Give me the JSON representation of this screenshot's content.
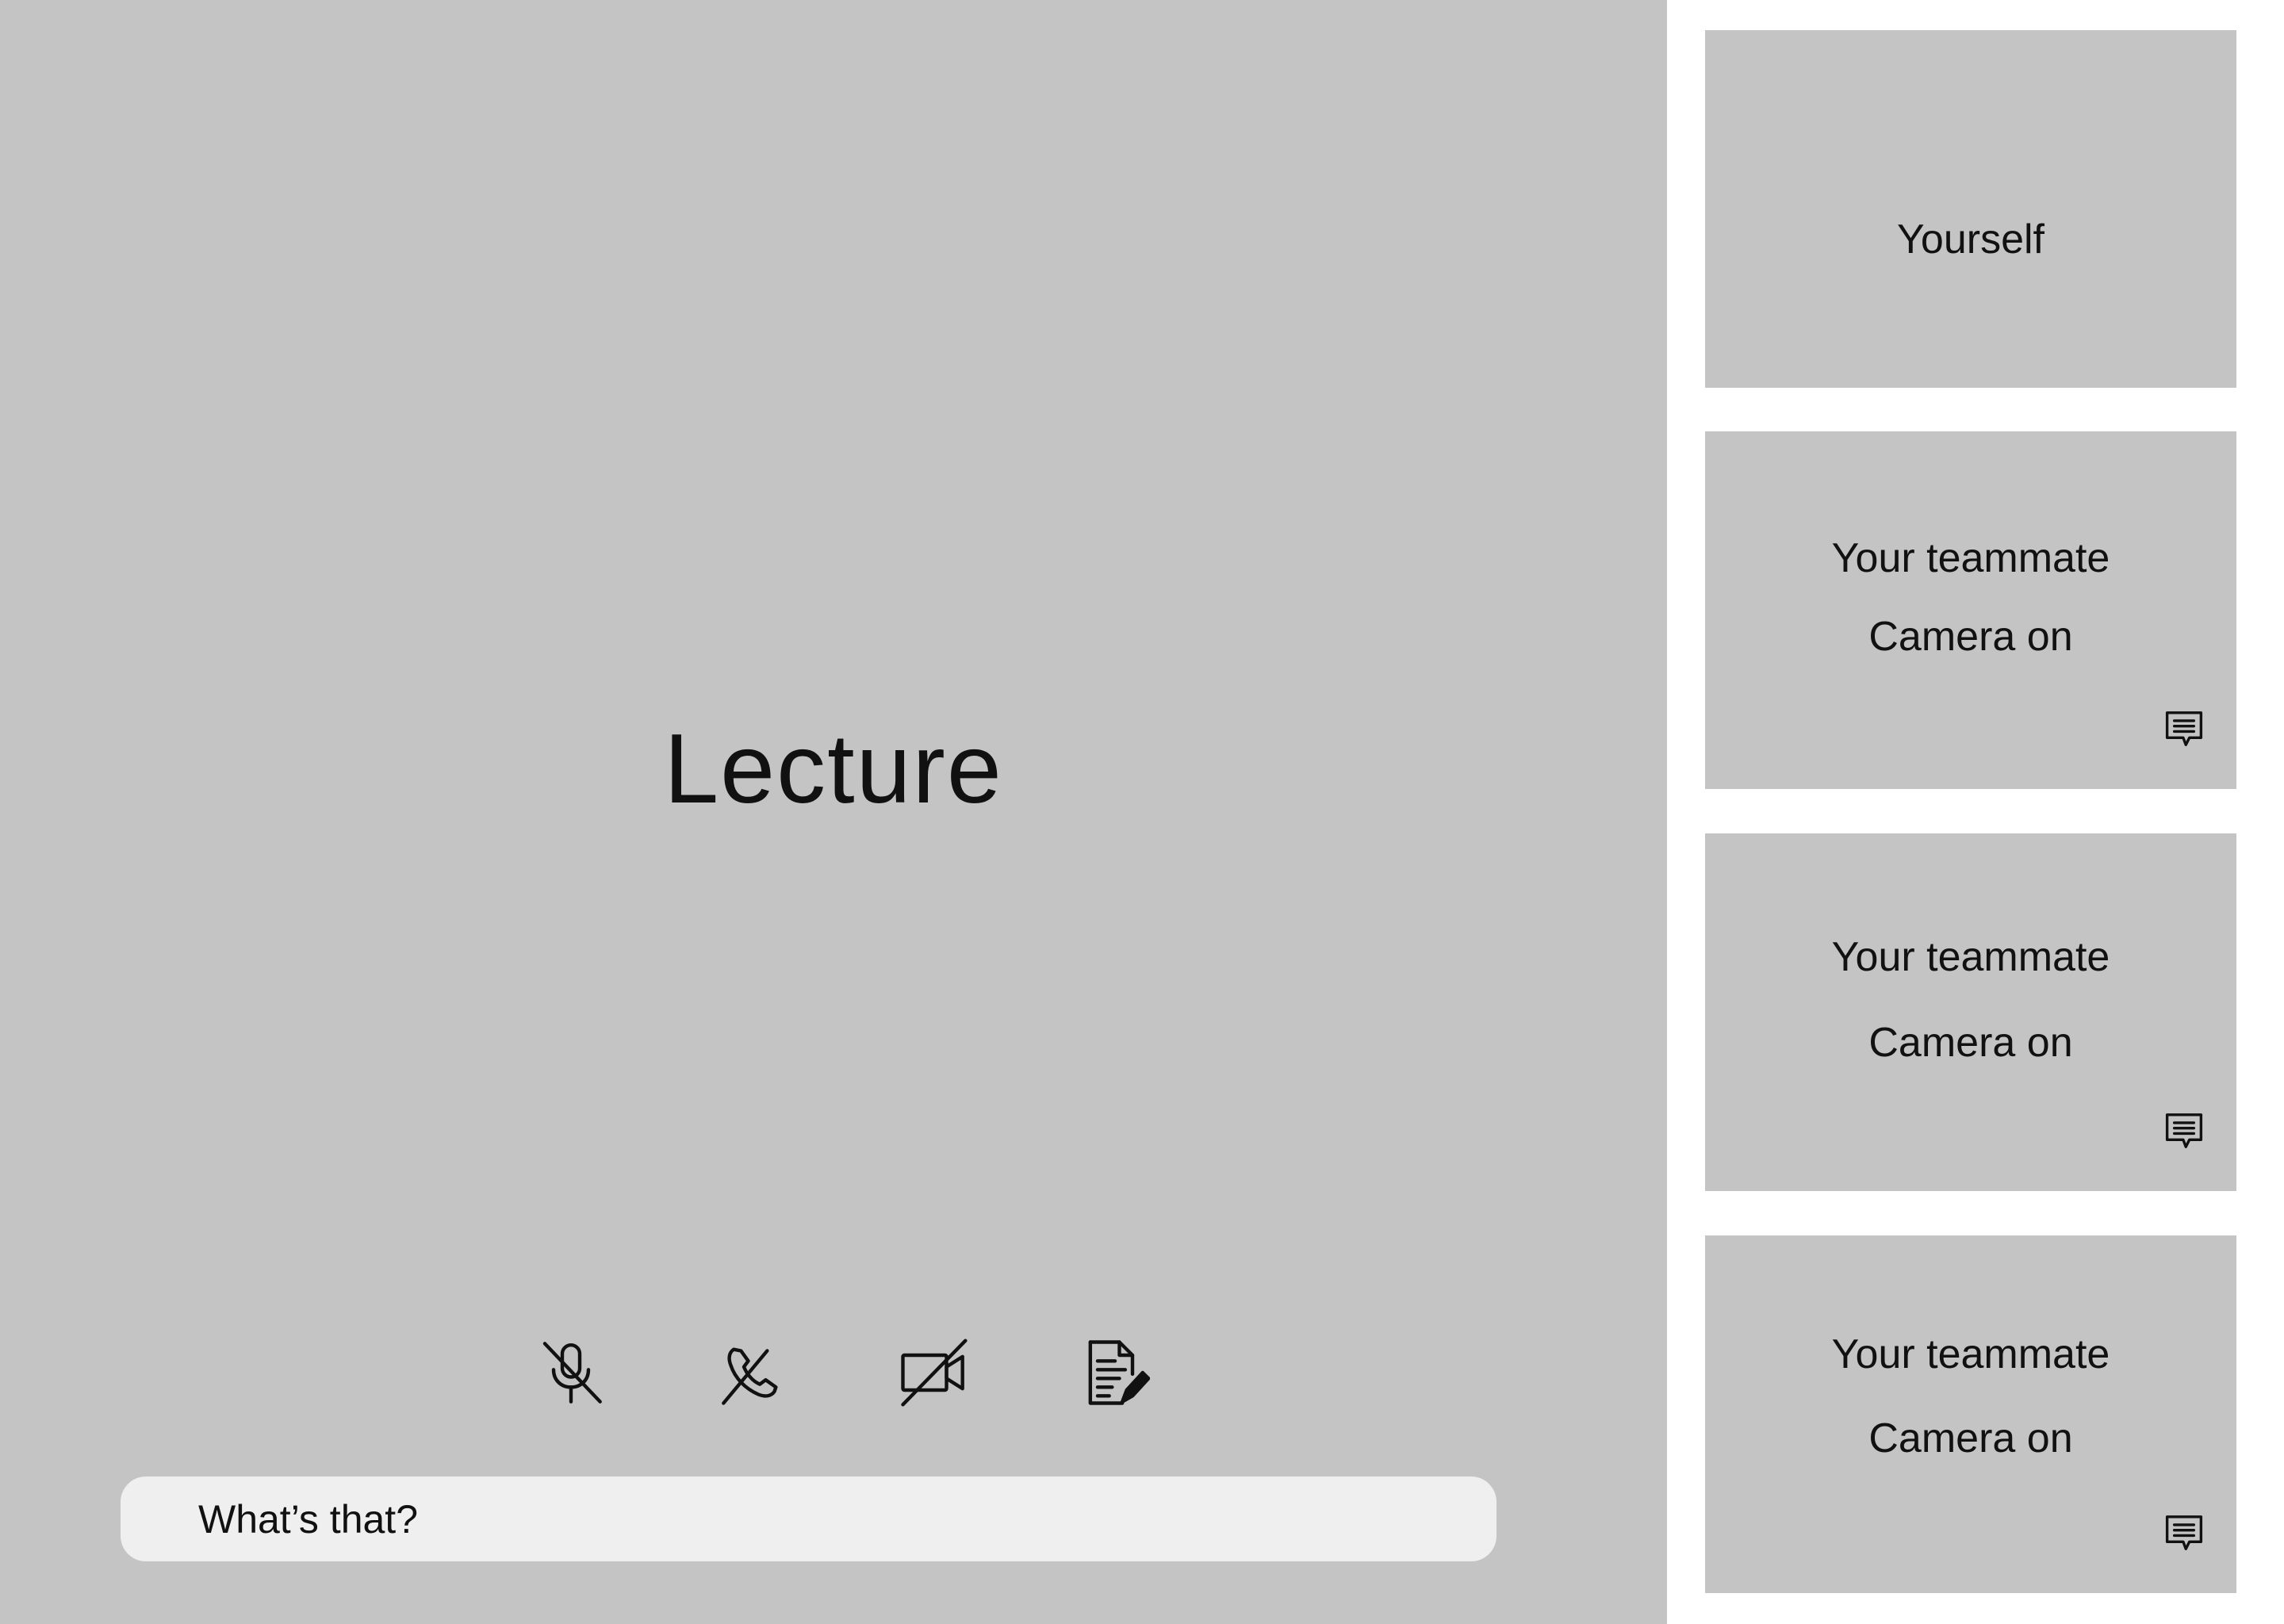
{
  "main": {
    "title": "Lecture",
    "chat_placeholder": "What’s that?",
    "controls": [
      {
        "icon": "microphone-off-icon"
      },
      {
        "icon": "phone-off-icon"
      },
      {
        "icon": "video-off-icon"
      },
      {
        "icon": "notes-edit-icon"
      }
    ]
  },
  "participants": [
    {
      "name": "Yourself"
    },
    {
      "name": "Your teammate",
      "status": "Camera on",
      "icon": "chat-icon"
    },
    {
      "name": "Your teammate",
      "status": "Camera on",
      "icon": "chat-icon"
    },
    {
      "name": "Your teammate",
      "status": "Camera on",
      "icon": "chat-icon"
    }
  ],
  "colors": {
    "stage_background": "#c4c4c4",
    "page_background": "#ffffff",
    "input_background": "#efefef",
    "text": "#111111"
  }
}
